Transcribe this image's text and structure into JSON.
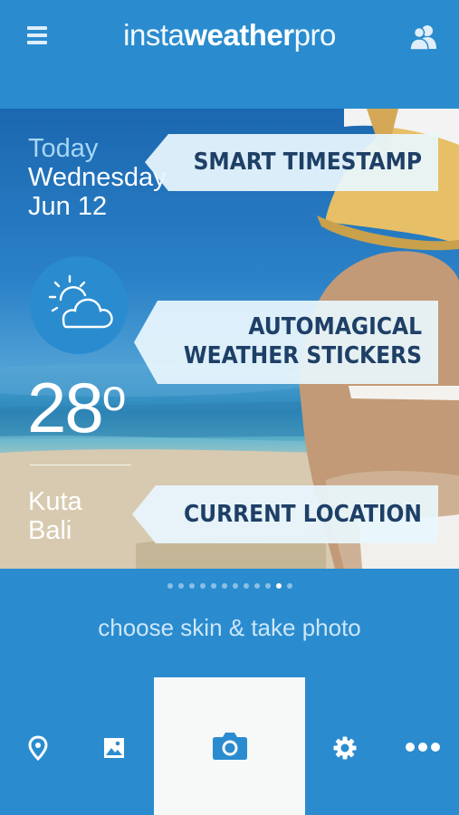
{
  "header": {
    "logo_part1": "insta",
    "logo_part2": "weather",
    "logo_part3": "pro",
    "menu_icon": "hamburger-menu-icon",
    "friends_icon": "friends-icon"
  },
  "card": {
    "today_label": "Today",
    "weekday": "Wednesday",
    "date": "Jun 12",
    "weather_icon": "partly-cloudy-icon",
    "temperature": "28",
    "degree": "o",
    "city": "Kuta",
    "region": "Bali"
  },
  "callouts": {
    "timestamp": "SMART TIMESTAMP",
    "stickers_line1": "AUTOMAGICAL",
    "stickers_line2": "WEATHER STICKERS",
    "location": "CURRENT LOCATION"
  },
  "pager": {
    "total": 12,
    "active_index": 10
  },
  "skin": {
    "prompt": "choose skin & take photo"
  },
  "bottom_nav": [
    {
      "name": "location",
      "icon": "location-pin-icon"
    },
    {
      "name": "gallery",
      "icon": "image-gallery-icon"
    },
    {
      "name": "camera",
      "icon": "camera-icon"
    },
    {
      "name": "settings",
      "icon": "gear-icon"
    },
    {
      "name": "more",
      "icon": "more-dots-icon"
    }
  ],
  "colors": {
    "primary": "#2a8ccf",
    "callout_text": "#1e3f66",
    "today_text": "#a6d7f5",
    "camera_tab_bg": "#f7f8f8"
  }
}
